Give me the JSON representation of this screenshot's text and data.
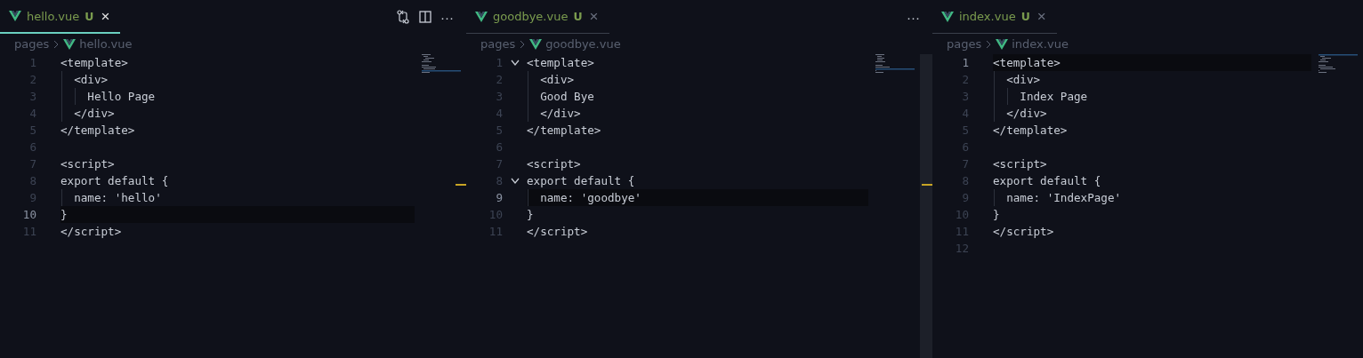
{
  "editor_groups": [
    {
      "focused": true,
      "tabs": [
        {
          "label": "hello.vue",
          "status": "U",
          "close": "×",
          "selected": true
        }
      ],
      "actions": [
        {
          "kind": "compare"
        },
        {
          "kind": "split"
        },
        {
          "kind": "more",
          "label": "···"
        }
      ],
      "breadcrumb": [
        "pages",
        "hello.vue"
      ],
      "overview_mark": true,
      "lines": [
        {
          "number": "1",
          "text": "<template>",
          "current": false
        },
        {
          "number": "2",
          "text": "  <div>",
          "current": false
        },
        {
          "number": "3",
          "text": "    Hello Page",
          "current": false
        },
        {
          "number": "4",
          "text": "  </div>",
          "current": false
        },
        {
          "number": "5",
          "text": "</template>",
          "current": false
        },
        {
          "number": "6",
          "current": false
        },
        {
          "number": "7",
          "text": "<script>",
          "current": false
        },
        {
          "number": "8",
          "text": "export default {",
          "current": false
        },
        {
          "number": "9",
          "text": "  name: 'hello'",
          "current": false
        },
        {
          "number": "10",
          "text": "}",
          "current": true
        },
        {
          "number": "11",
          "text": "</script>",
          "current": false
        }
      ]
    },
    {
      "focused": false,
      "tabs": [
        {
          "label": "goodbye.vue",
          "status": "U",
          "close": "×",
          "selected": true
        }
      ],
      "actions": [
        {
          "kind": "more",
          "label": "···"
        }
      ],
      "breadcrumb": [
        "pages",
        "goodbye.vue"
      ],
      "overview_mark": true,
      "scrollbar": true,
      "lines": [
        {
          "number": "1",
          "text": "<template>",
          "current": false,
          "foldable": true
        },
        {
          "number": "2",
          "text": "  <div>",
          "current": false
        },
        {
          "number": "3",
          "text": "  Good Bye",
          "current": false
        },
        {
          "number": "4",
          "text": "  </div>",
          "current": false
        },
        {
          "number": "5",
          "text": "</template>",
          "current": false
        },
        {
          "number": "6",
          "current": false
        },
        {
          "number": "7",
          "text": "<script>",
          "current": false
        },
        {
          "number": "8",
          "text": "export default {",
          "current": false,
          "foldable": true
        },
        {
          "number": "9",
          "text": "  name: 'goodbye'",
          "current": true
        },
        {
          "number": "10",
          "text": "}",
          "current": false
        },
        {
          "number": "11",
          "text": "</script>",
          "current": false
        }
      ]
    },
    {
      "focused": false,
      "tabs": [
        {
          "label": "index.vue",
          "status": "U",
          "close": "×",
          "selected": true
        }
      ],
      "breadcrumb": [
        "pages",
        "index.vue"
      ],
      "lines": [
        {
          "number": "1",
          "text": "<template>",
          "current": true
        },
        {
          "number": "2",
          "text": "  <div>",
          "current": false
        },
        {
          "number": "3",
          "text": "    Index Page",
          "current": false
        },
        {
          "number": "4",
          "text": "  </div>",
          "current": false
        },
        {
          "number": "5",
          "text": "</template>",
          "current": false
        },
        {
          "number": "6",
          "current": false
        },
        {
          "number": "7",
          "text": "<script>",
          "current": false
        },
        {
          "number": "8",
          "text": "export default {",
          "current": false
        },
        {
          "number": "9",
          "text": "  name: 'IndexPage'",
          "current": false
        },
        {
          "number": "10",
          "text": "}",
          "current": false
        },
        {
          "number": "11",
          "text": "</script>",
          "current": false
        },
        {
          "number": "12",
          "current": false
        }
      ]
    }
  ]
}
